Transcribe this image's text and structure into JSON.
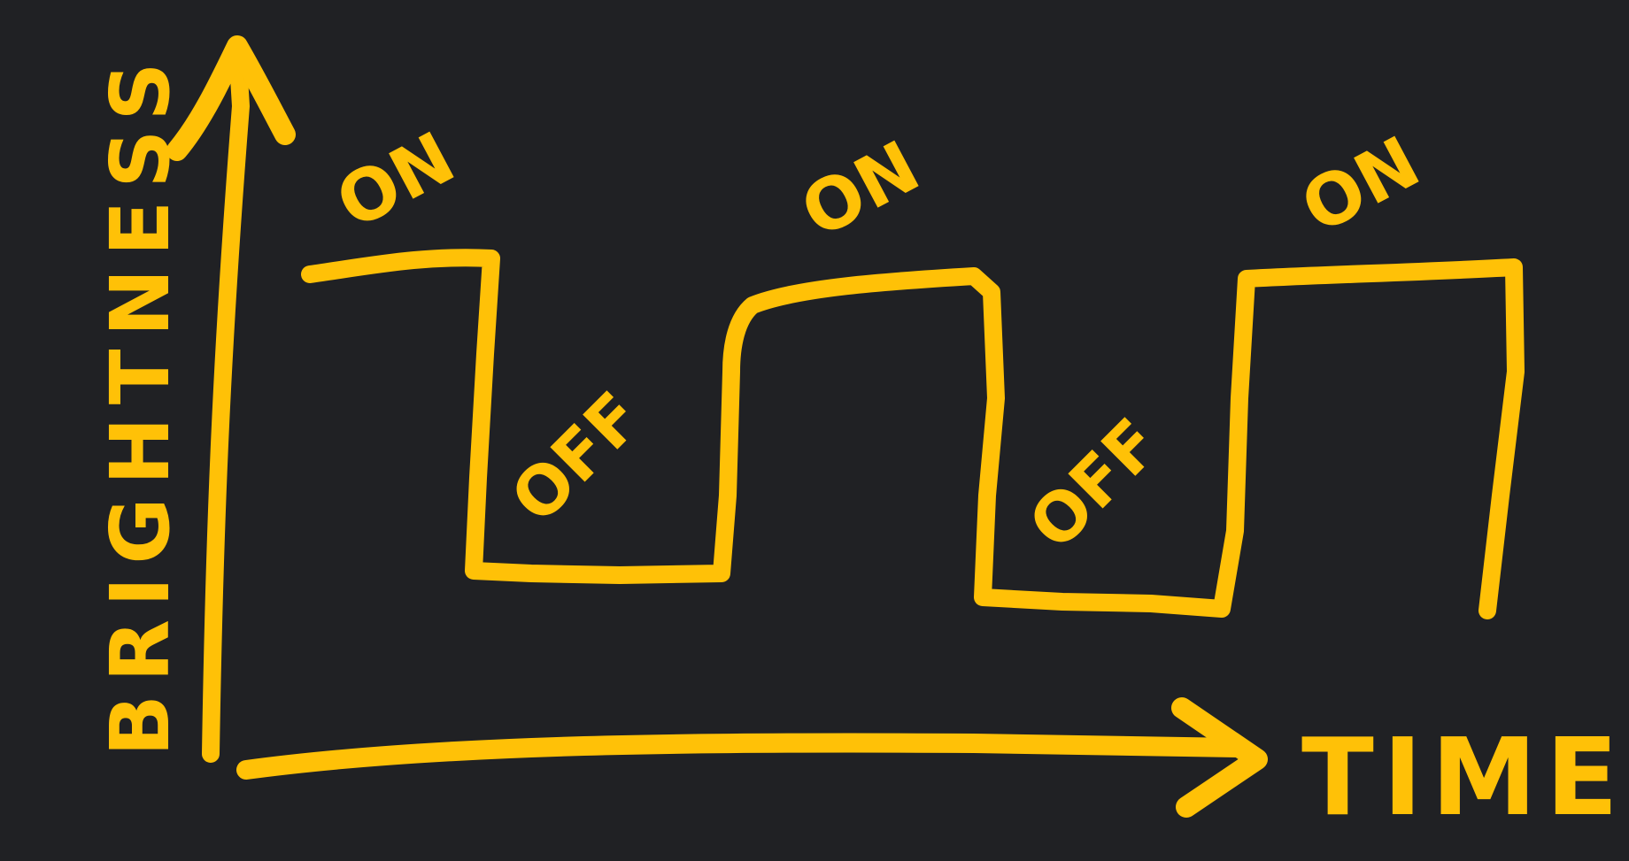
{
  "colors": {
    "background": "#202124",
    "ink": "#FFC107"
  },
  "axes": {
    "y_label": "BRIGHTNESS",
    "x_label": "TIME"
  },
  "states": [
    {
      "label": "ON",
      "level": "high"
    },
    {
      "label": "OFF",
      "level": "low"
    },
    {
      "label": "ON",
      "level": "high"
    },
    {
      "label": "OFF",
      "level": "low"
    },
    {
      "label": "ON",
      "level": "high"
    }
  ]
}
